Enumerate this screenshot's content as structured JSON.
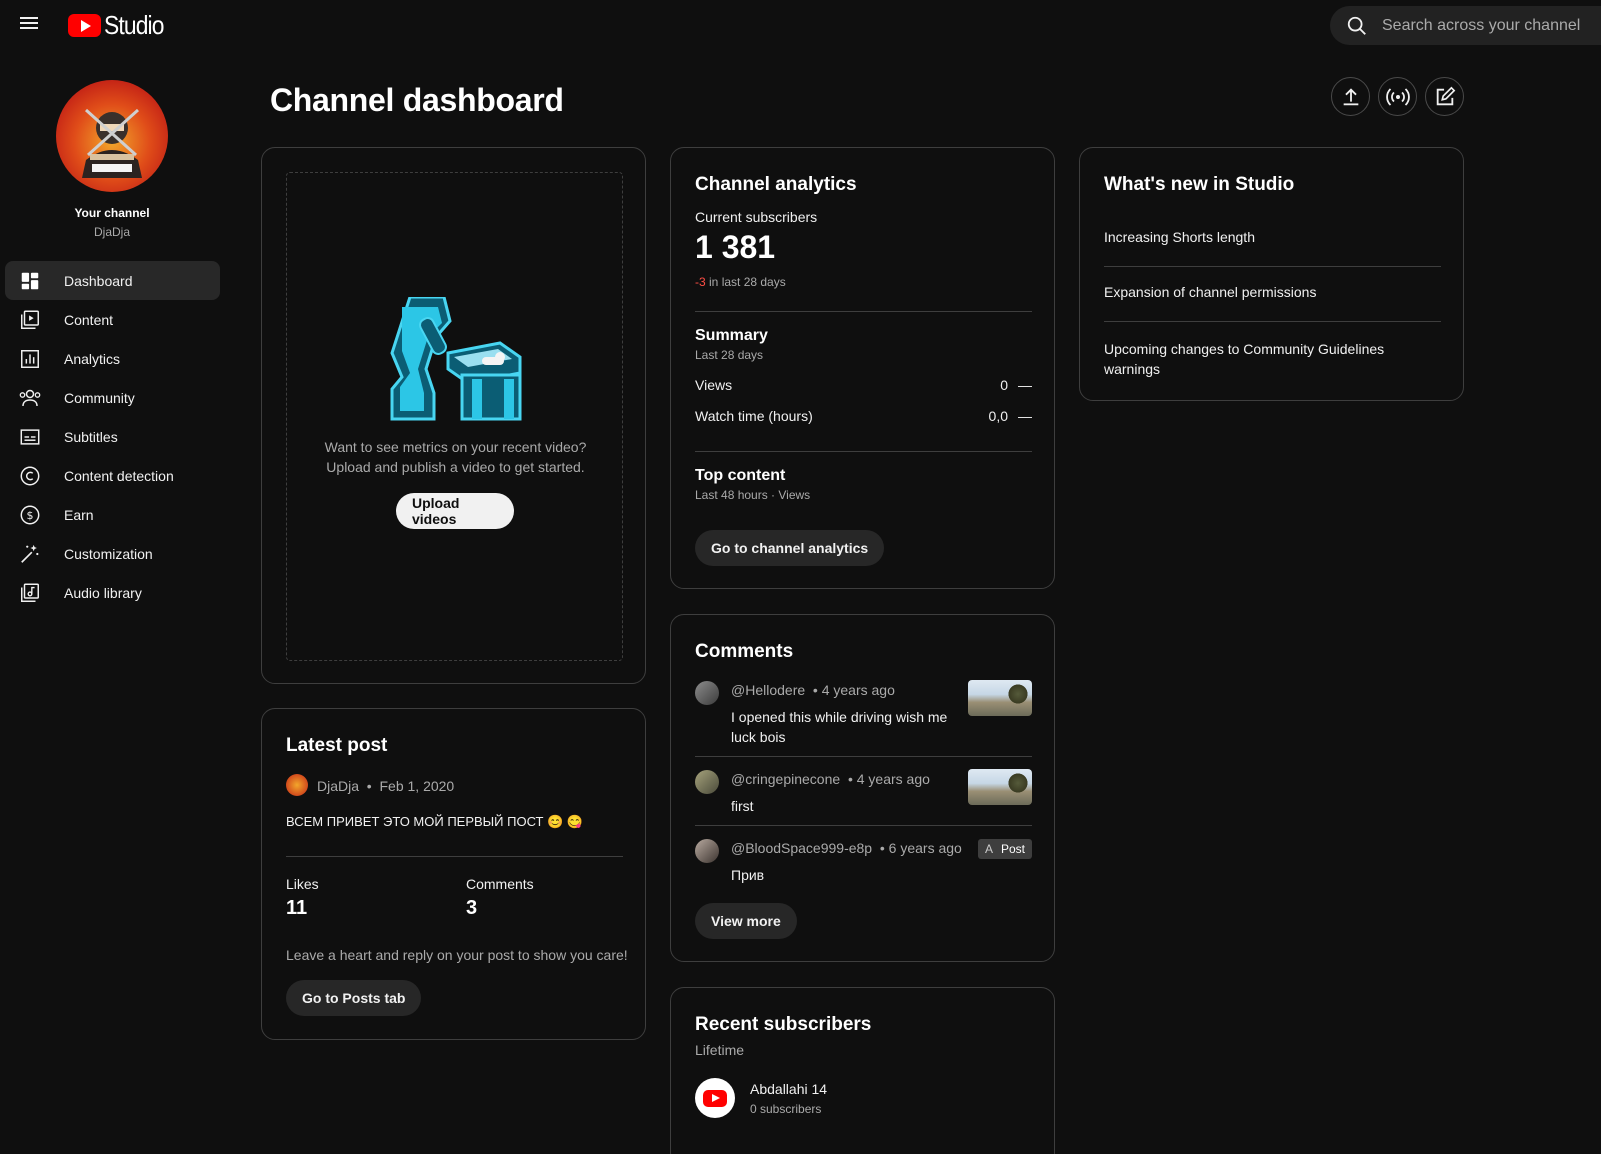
{
  "header": {
    "app_name": "Studio",
    "search_placeholder": "Search across your channel"
  },
  "sidebar": {
    "your_channel_label": "Your channel",
    "channel_name": "DjaDja",
    "items": [
      {
        "label": "Dashboard",
        "icon": "dashboard-icon",
        "active": true
      },
      {
        "label": "Content",
        "icon": "content-icon"
      },
      {
        "label": "Analytics",
        "icon": "analytics-icon"
      },
      {
        "label": "Community",
        "icon": "community-icon"
      },
      {
        "label": "Subtitles",
        "icon": "subtitles-icon"
      },
      {
        "label": "Content detection",
        "icon": "copyright-icon"
      },
      {
        "label": "Earn",
        "icon": "dollar-icon"
      },
      {
        "label": "Customization",
        "icon": "magic-wand-icon"
      },
      {
        "label": "Audio library",
        "icon": "audio-library-icon"
      }
    ]
  },
  "page": {
    "title": "Channel dashboard"
  },
  "upload_card": {
    "message_line1": "Want to see metrics on your recent video?",
    "message_line2": "Upload and publish a video to get started.",
    "button": "Upload videos"
  },
  "latest_post": {
    "title": "Latest post",
    "author": "DjaDja",
    "separator": "•",
    "date": "Feb 1, 2020",
    "text": "ВСЕМ ПРИВЕТ ЭТО МОЙ ПЕРВЫЙ ПОСТ 😊 😋",
    "likes_label": "Likes",
    "likes_value": "11",
    "comments_label": "Comments",
    "comments_value": "3",
    "hint": "Leave a heart and reply on your post to show you care!",
    "button": "Go to Posts tab"
  },
  "analytics": {
    "title": "Channel analytics",
    "subscribers_label": "Current subscribers",
    "subscribers_value": "1 381",
    "change_value": "-3",
    "change_suffix": "in last 28 days",
    "summary_title": "Summary",
    "summary_period": "Last 28 days",
    "metrics": [
      {
        "label": "Views",
        "value": "0",
        "trend": "—"
      },
      {
        "label": "Watch time (hours)",
        "value": "0,0",
        "trend": "—"
      }
    ],
    "top_content_title": "Top content",
    "top_content_period": "Last 48 hours · Views",
    "button": "Go to channel analytics"
  },
  "comments": {
    "title": "Comments",
    "items": [
      {
        "author": "@Hellodere",
        "time": "• 4 years ago",
        "text": "I opened this while driving wish me luck bois"
      },
      {
        "author": "@cringepinecone",
        "time": "• 4 years ago",
        "text": "first"
      },
      {
        "author": "@BloodSpace999-e8p",
        "time": "• 6 years ago",
        "text": "Прив",
        "tag_prefix": "A",
        "tag": "Post"
      }
    ],
    "button": "View more"
  },
  "whats_new": {
    "title": "What's new in Studio",
    "items": [
      "Increasing Shorts length",
      "Expansion of channel permissions",
      "Upcoming changes to Community Guidelines warnings"
    ]
  },
  "recent_subscribers": {
    "title": "Recent subscribers",
    "period": "Lifetime",
    "items": [
      {
        "name": "Abdallahi 14",
        "subs": "0 subscribers"
      }
    ]
  },
  "colors": {
    "background": "#0f0f0f",
    "brand_red": "#ff0000",
    "negative": "#ff4e45",
    "card_border": "#3e3e3e"
  }
}
